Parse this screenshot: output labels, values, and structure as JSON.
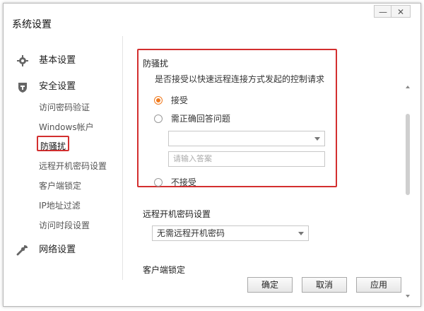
{
  "window": {
    "title": "系统设置",
    "minimize_label": "—",
    "close_label": "✕"
  },
  "sidebar": {
    "sections": [
      {
        "label": "基本设置",
        "icon": "gear-icon"
      },
      {
        "label": "安全设置",
        "icon": "shield-icon"
      },
      {
        "label": "网络设置",
        "icon": "wrench-icon"
      }
    ],
    "security_items": [
      {
        "label": "访问密码验证"
      },
      {
        "label": "Windows帐户"
      },
      {
        "label": "防骚扰"
      },
      {
        "label": "远程开机密码设置"
      },
      {
        "label": "客户端锁定"
      },
      {
        "label": "IP地址过滤"
      },
      {
        "label": "访问时段设置"
      }
    ],
    "active_item": "防骚扰"
  },
  "content": {
    "anti_harass": {
      "title": "防骚扰",
      "question": "是否接受以快速远程连接方式发起的控制请求",
      "options": [
        {
          "label": "接受",
          "checked": true
        },
        {
          "label": "需正确回答问题",
          "checked": false
        },
        {
          "label": "不接受",
          "checked": false
        }
      ],
      "question_select_value": "",
      "answer_placeholder": "请输入答案"
    },
    "remote_boot": {
      "title": "远程开机密码设置",
      "select_value": "无需远程开机密码"
    },
    "client_lock": {
      "title": "客户端锁定"
    }
  },
  "footer": {
    "ok_label": "确定",
    "cancel_label": "取消",
    "apply_label": "应用"
  },
  "colors": {
    "highlight_red": "#d32f2f",
    "radio_accent": "#f07a1e"
  }
}
